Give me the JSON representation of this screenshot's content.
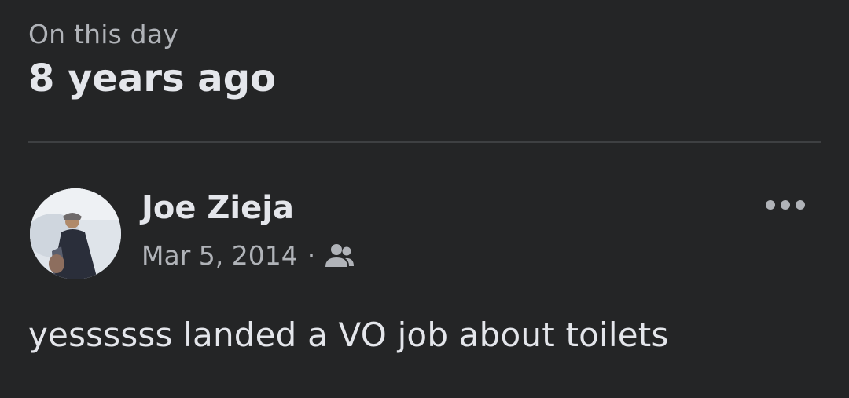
{
  "header": {
    "label": "On this day",
    "title": "8 years ago"
  },
  "post": {
    "author": "Joe Zieja",
    "date": "Mar 5, 2014",
    "separator": "·",
    "audience_icon": "friends-icon",
    "more_icon": "more-horizontal-icon",
    "text": "yessssss landed a VO job about toilets"
  },
  "colors": {
    "background": "#242526",
    "primary_text": "#e4e6eb",
    "secondary_text": "#b0b3b8",
    "divider": "#3e4042"
  }
}
